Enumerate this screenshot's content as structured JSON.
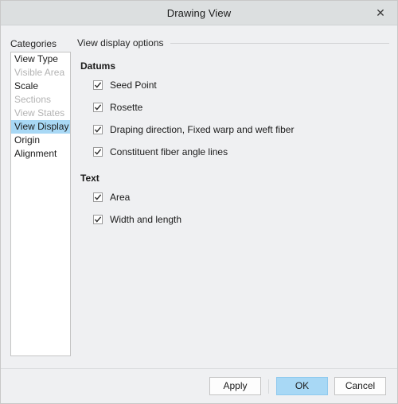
{
  "window": {
    "title": "Drawing View",
    "close_icon": "close-icon",
    "close_glyph": "✕"
  },
  "sidebar": {
    "label": "Categories",
    "items": [
      {
        "label": "View Type",
        "state": "normal"
      },
      {
        "label": "Visible Area",
        "state": "disabled"
      },
      {
        "label": "Scale",
        "state": "normal"
      },
      {
        "label": "Sections",
        "state": "disabled"
      },
      {
        "label": "View States",
        "state": "disabled"
      },
      {
        "label": "View Display",
        "state": "selected"
      },
      {
        "label": "Origin",
        "state": "normal"
      },
      {
        "label": "Alignment",
        "state": "normal"
      }
    ]
  },
  "panel": {
    "header": "View display options",
    "groups": [
      {
        "title": "Datums",
        "options": [
          {
            "label": "Seed Point",
            "checked": true
          },
          {
            "label": "Rosette",
            "checked": true
          },
          {
            "label": "Draping direction, Fixed warp and weft fiber",
            "checked": true
          },
          {
            "label": "Constituent fiber angle lines",
            "checked": true
          }
        ]
      },
      {
        "title": "Text",
        "options": [
          {
            "label": "Area",
            "checked": true
          },
          {
            "label": "Width and length",
            "checked": true
          }
        ]
      }
    ]
  },
  "footer": {
    "apply_label": "Apply",
    "ok_label": "OK",
    "cancel_label": "Cancel"
  },
  "colors": {
    "selection": "#a8d8f5",
    "dialog_bg": "#eff0f2",
    "titlebar_bg": "#dcdfe0",
    "disabled_text": "#b3b3b3"
  }
}
